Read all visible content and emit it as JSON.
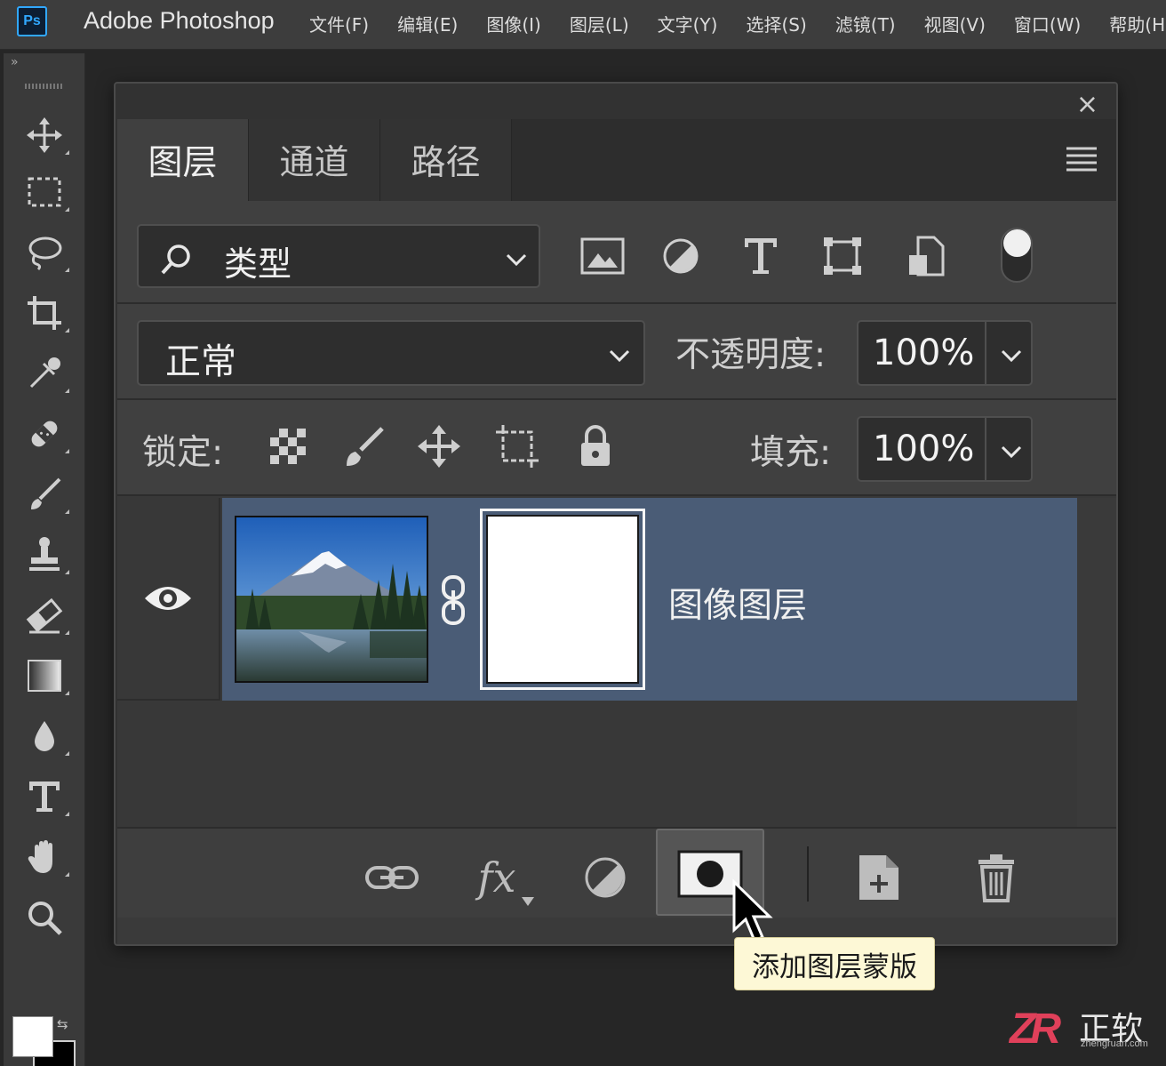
{
  "app": {
    "title": "Adobe Photoshop",
    "logo": "Ps"
  },
  "menu": [
    "文件(F)",
    "编辑(E)",
    "图像(I)",
    "图层(L)",
    "文字(Y)",
    "选择(S)",
    "滤镜(T)",
    "视图(V)",
    "窗口(W)",
    "帮助(H)"
  ],
  "toolbar": {
    "collapse": "»",
    "tools": [
      "move-icon",
      "marquee-icon",
      "lasso-icon",
      "crop-icon",
      "eyedropper-icon",
      "healing-icon",
      "brush-icon",
      "stamp-icon",
      "eraser-icon",
      "gradient-icon",
      "blur-icon",
      "type-icon",
      "hand-icon",
      "zoom-icon"
    ],
    "foreground_color": "#ffffff",
    "background_color": "#000000"
  },
  "panel": {
    "close": "×",
    "tabs": [
      "图层",
      "通道",
      "路径"
    ],
    "active_tab": "图层",
    "filter": {
      "value": "类型",
      "icons": [
        "image-filter-icon",
        "adjustment-filter-icon",
        "type-filter-icon",
        "shape-filter-icon",
        "smart-object-filter-icon"
      ]
    },
    "blend_mode": "正常",
    "opacity": {
      "label": "不透明度:",
      "value": "100%"
    },
    "lock": {
      "label": "锁定:",
      "icons": [
        "lock-transparent-icon",
        "lock-image-icon",
        "lock-position-icon",
        "lock-artboard-icon",
        "lock-all-icon"
      ]
    },
    "fill": {
      "label": "填充:",
      "value": "100%"
    },
    "layers": [
      {
        "name": "图像图层",
        "visible": true,
        "has_mask": true,
        "selected": true
      }
    ],
    "bottom_icons": [
      "link-layers-icon",
      "fx-icon",
      "adjustment-layer-icon",
      "add-mask-icon",
      "new-layer-icon",
      "delete-icon"
    ],
    "fx_label": "fx"
  },
  "tooltip": "添加图层蒙版",
  "watermark": {
    "logo": "ZR",
    "name": "正软",
    "sub": "zhengruan.com"
  },
  "colors": {
    "accent": "#31a8ff",
    "selected_row": "#4a5c76",
    "tooltip_bg": "#fdf8d6"
  }
}
